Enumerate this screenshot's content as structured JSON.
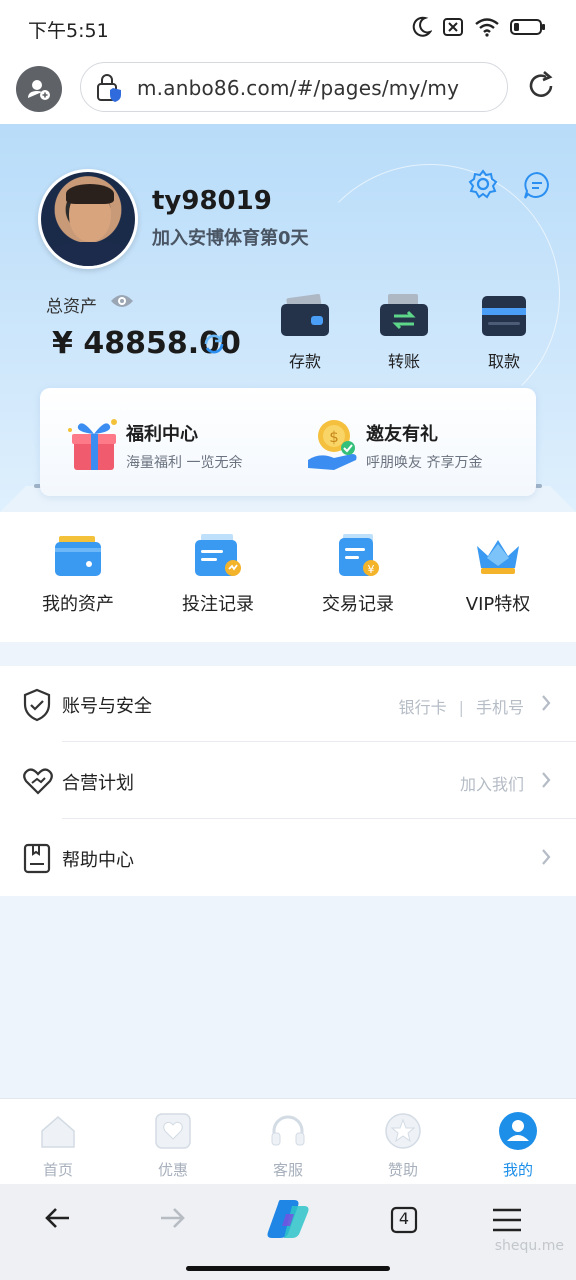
{
  "status_bar": {
    "time": "下午5:51",
    "icons": [
      "moon-icon",
      "no-sim-icon",
      "wifi-icon",
      "battery-icon"
    ]
  },
  "browser": {
    "url": "m.anbo86.com/#/pages/my/my",
    "tab_count": "4"
  },
  "profile": {
    "username": "ty98019",
    "join_text": "加入安博体育第0天"
  },
  "assets": {
    "label": "总资产",
    "value": "¥ 48858.00"
  },
  "actions": [
    {
      "label": "存款",
      "icon": "wallet-icon"
    },
    {
      "label": "转账",
      "icon": "transfer-icon"
    },
    {
      "label": "取款",
      "icon": "withdraw-icon"
    }
  ],
  "promos": [
    {
      "title": "福利中心",
      "subtitle": "海量福利 一览无余",
      "icon": "gift-icon"
    },
    {
      "title": "邀友有礼",
      "subtitle": "呼朋唤友 齐享万金",
      "icon": "coin-hand-icon"
    }
  ],
  "quick_menu": [
    {
      "label": "我的资产",
      "icon": "card-icon"
    },
    {
      "label": "投注记录",
      "icon": "bet-record-icon"
    },
    {
      "label": "交易记录",
      "icon": "transaction-record-icon"
    },
    {
      "label": "VIP特权",
      "icon": "crown-icon"
    }
  ],
  "list": [
    {
      "label": "账号与安全",
      "right_a": "银行卡",
      "sep": "|",
      "right_b": "手机号",
      "icon": "shield-icon"
    },
    {
      "label": "合营计划",
      "right_a": "加入我们",
      "icon": "handshake-heart-icon"
    },
    {
      "label": "帮助中心",
      "icon": "help-book-icon"
    }
  ],
  "tabs": [
    {
      "label": "首页",
      "icon": "home-icon"
    },
    {
      "label": "优惠",
      "icon": "promo-heart-icon"
    },
    {
      "label": "客服",
      "icon": "headset-icon"
    },
    {
      "label": "赞助",
      "icon": "star-icon"
    },
    {
      "label": "我的",
      "icon": "user-icon",
      "active": true
    }
  ],
  "watermark": "shequ.me",
  "colors": {
    "accent": "#1d8fe8",
    "header_top": "#b8dcf9",
    "muted": "#b5bcc6"
  }
}
